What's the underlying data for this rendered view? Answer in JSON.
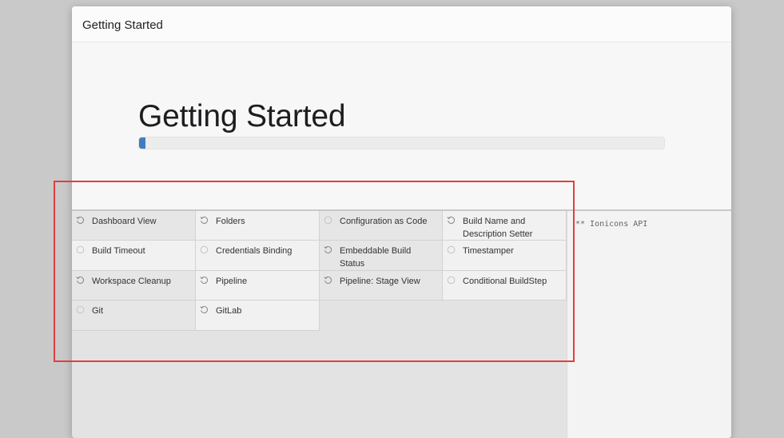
{
  "dialog": {
    "title": "Getting Started"
  },
  "hero": {
    "title": "Getting Started",
    "progress_fraction": 0.012
  },
  "plugins": [
    {
      "label": "Dashboard View",
      "status": "installing"
    },
    {
      "label": "Folders",
      "status": "installing"
    },
    {
      "label": "Configuration as Code",
      "status": "pending"
    },
    {
      "label": "Build Name and Description Setter",
      "status": "installing"
    },
    {
      "label": "Build Timeout",
      "status": "pending"
    },
    {
      "label": "Credentials Binding",
      "status": "pending"
    },
    {
      "label": "Embeddable Build Status",
      "status": "installing"
    },
    {
      "label": "Timestamper",
      "status": "pending"
    },
    {
      "label": "Workspace Cleanup",
      "status": "installing"
    },
    {
      "label": "Pipeline",
      "status": "installing"
    },
    {
      "label": "Pipeline: Stage View",
      "status": "installing"
    },
    {
      "label": "Conditional BuildStep",
      "status": "pending"
    },
    {
      "label": "Git",
      "status": "pending"
    },
    {
      "label": "GitLab",
      "status": "installing"
    }
  ],
  "log": {
    "line": "** Ionicons API"
  },
  "colors": {
    "progress": "#3f7dbf",
    "highlight": "#e43d3d"
  }
}
